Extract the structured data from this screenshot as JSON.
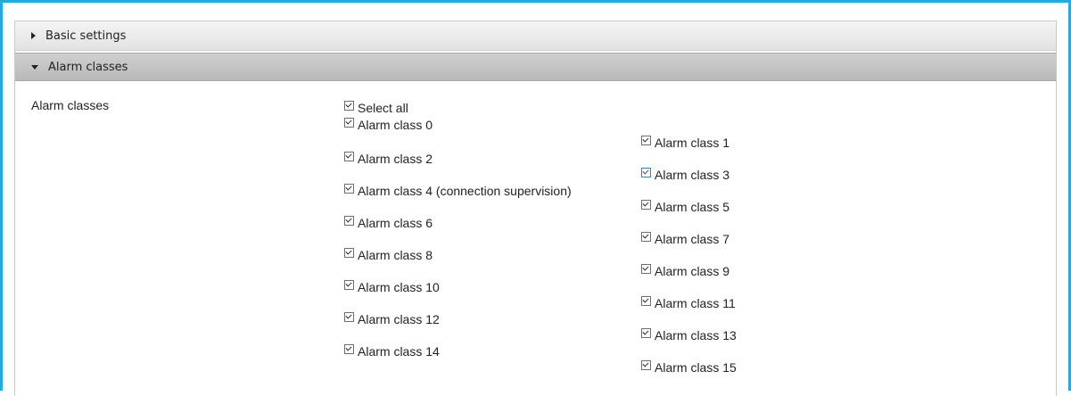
{
  "sections": {
    "basic": {
      "label": "Basic settings",
      "expanded": false
    },
    "alarm": {
      "label": "Alarm classes",
      "expanded": true
    }
  },
  "field_label": "Alarm classes",
  "select_all": {
    "label": "Select all",
    "checked": true
  },
  "left_column": [
    {
      "label": "Alarm class 0",
      "checked": true
    },
    {
      "label": "Alarm class 2",
      "checked": true
    },
    {
      "label": "Alarm class 4 (connection supervision)",
      "checked": true
    },
    {
      "label": "Alarm class 6",
      "checked": true
    },
    {
      "label": "Alarm class 8",
      "checked": true
    },
    {
      "label": "Alarm class 10",
      "checked": true
    },
    {
      "label": "Alarm class 12",
      "checked": true
    },
    {
      "label": "Alarm class 14",
      "checked": true
    }
  ],
  "right_column": [
    {
      "label": "Alarm class 1",
      "checked": true
    },
    {
      "label": "Alarm class 3",
      "checked": true,
      "focused": true
    },
    {
      "label": "Alarm class 5",
      "checked": true
    },
    {
      "label": "Alarm class 7",
      "checked": true
    },
    {
      "label": "Alarm class 9",
      "checked": true
    },
    {
      "label": "Alarm class 11",
      "checked": true
    },
    {
      "label": "Alarm class 13",
      "checked": true
    },
    {
      "label": "Alarm class 15",
      "checked": true
    }
  ],
  "colors": {
    "frame_border": "#29a8e0"
  }
}
